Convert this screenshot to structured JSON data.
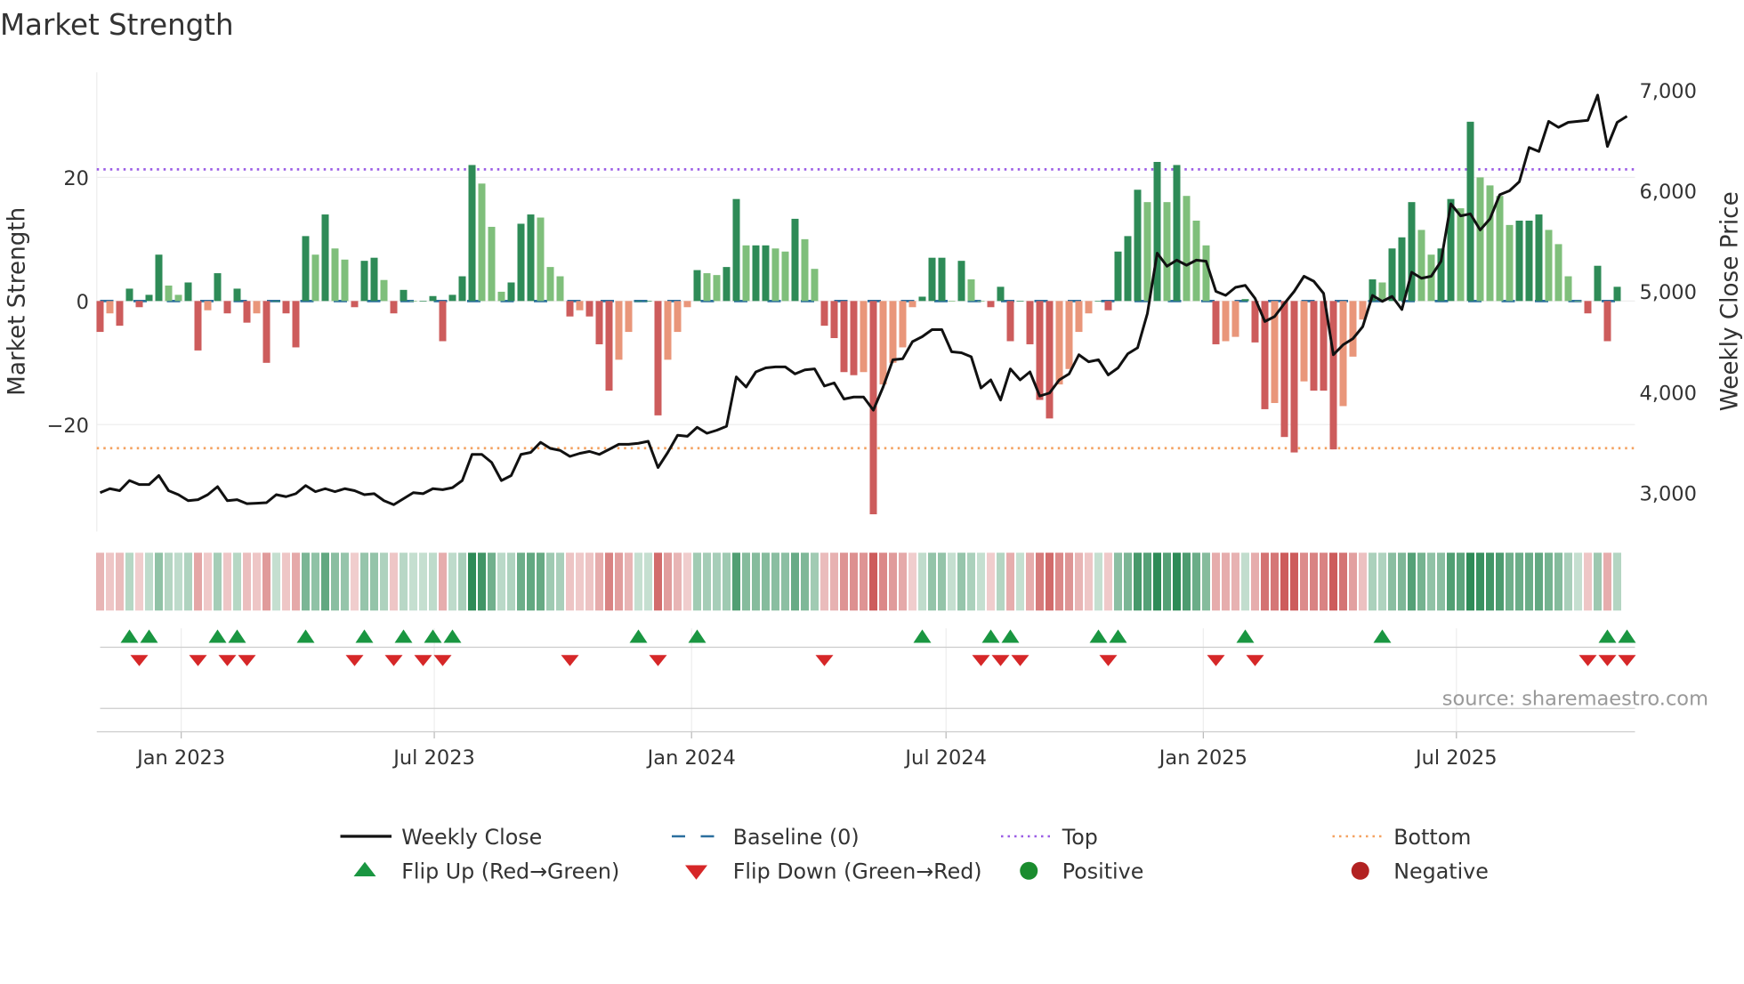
{
  "chart_data": {
    "type": "bar+line",
    "title": "Market Strength",
    "ylabel_left": "Market Strength",
    "ylabel_right": "Weekly Close Price",
    "start_date": "2022-11-04",
    "frequency": "weekly",
    "ylim_left": [
      -37.3,
      37
    ],
    "ylim_right": [
      2613,
      7177
    ],
    "left_ticks": [
      {
        "value": 20,
        "label": "20"
      },
      {
        "value": 0,
        "label": "0"
      },
      {
        "value": -20,
        "label": "−20"
      }
    ],
    "right_ticks": [
      {
        "value": 7000,
        "label": "7,000"
      },
      {
        "value": 6000,
        "label": "6,000"
      },
      {
        "value": 5000,
        "label": "5,000"
      },
      {
        "value": 4000,
        "label": "4,000"
      },
      {
        "value": 3000,
        "label": "3,000"
      }
    ],
    "x_ticks": [
      {
        "date": "2023-01-01",
        "label": "Jan 2023"
      },
      {
        "date": "2023-07-01",
        "label": "Jul 2023"
      },
      {
        "date": "2024-01-01",
        "label": "Jan 2024"
      },
      {
        "date": "2024-07-01",
        "label": "Jul 2024"
      },
      {
        "date": "2025-01-01",
        "label": "Jan 2025"
      },
      {
        "date": "2025-07-01",
        "label": "Jul 2025"
      }
    ],
    "top_level": 21.3,
    "bottom_level": -23.8,
    "strength": [
      -5,
      -2,
      -4,
      2,
      -1,
      1,
      7.5,
      2.5,
      1,
      3,
      -8,
      -1.5,
      4.5,
      -2,
      2,
      -3.5,
      -2,
      -10,
      0,
      -2,
      -7.5,
      10.5,
      7.5,
      14,
      8.5,
      6.7,
      -1,
      6.5,
      7,
      3.4,
      -2,
      1.8,
      0,
      0,
      0.8,
      -6.5,
      1,
      4,
      22,
      19,
      12,
      1.5,
      3,
      12.5,
      14,
      13.5,
      5.5,
      4,
      -2.5,
      -1.5,
      -2.5,
      -7,
      -14.5,
      -9.5,
      -5,
      0,
      0,
      -18.5,
      -9.5,
      -5,
      -1,
      5,
      4.5,
      4.2,
      5.5,
      16.5,
      9,
      9,
      9,
      8.5,
      8,
      13.3,
      10,
      5.2,
      -4,
      -6,
      -11.5,
      -12,
      -11.5,
      -34.5,
      -13.5,
      -10,
      -7.5,
      -1,
      0.7,
      7,
      7,
      0,
      6.5,
      3.5,
      0,
      -1,
      2.3,
      -6.5,
      0,
      -7,
      -16,
      -19,
      -13.5,
      -11,
      -5,
      -2,
      0,
      -1.5,
      8,
      10.5,
      18,
      16,
      22.5,
      16,
      22,
      17,
      13,
      9,
      -7,
      -6.5,
      -5.8,
      0.3,
      -6.7,
      -17.5,
      -16.5,
      -22,
      -24.5,
      -13,
      -14.5,
      -14.5,
      -24,
      -17,
      -9,
      -3,
      3.5,
      3,
      8.5,
      10.3,
      16,
      11.5,
      7.5,
      8.5,
      16.5,
      15,
      29,
      20,
      18.7,
      17,
      12.3,
      13,
      13,
      14,
      11.5,
      9.2,
      4,
      0,
      -2,
      5.7,
      -6.5,
      2.3
    ],
    "weekly_close": [
      3000,
      3040,
      3020,
      3120,
      3080,
      3080,
      3170,
      3020,
      2980,
      2920,
      2930,
      2980,
      3060,
      2920,
      2930,
      2890,
      2895,
      2900,
      2980,
      2960,
      2990,
      3070,
      3010,
      3040,
      3010,
      3040,
      3020,
      2980,
      2990,
      2920,
      2880,
      2940,
      3000,
      2990,
      3040,
      3030,
      3050,
      3120,
      3380,
      3380,
      3300,
      3120,
      3170,
      3380,
      3400,
      3500,
      3440,
      3420,
      3360,
      3390,
      3410,
      3380,
      3430,
      3480,
      3480,
      3490,
      3510,
      3250,
      3400,
      3570,
      3560,
      3650,
      3590,
      3620,
      3660,
      4150,
      4050,
      4200,
      4240,
      4250,
      4250,
      4180,
      4220,
      4230,
      4060,
      4090,
      3930,
      3950,
      3950,
      3820,
      4050,
      4320,
      4330,
      4500,
      4550,
      4620,
      4620,
      4400,
      4390,
      4350,
      4040,
      4120,
      3920,
      4230,
      4120,
      4200,
      3960,
      3990,
      4120,
      4180,
      4370,
      4300,
      4320,
      4170,
      4240,
      4380,
      4440,
      4780,
      5380,
      5250,
      5310,
      5260,
      5310,
      5300,
      5000,
      4960,
      5040,
      5060,
      4930,
      4700,
      4750,
      4880,
      5000,
      5150,
      5100,
      4980,
      4370,
      4470,
      4530,
      4650,
      4960,
      4900,
      4950,
      4820,
      5190,
      5130,
      5150,
      5300,
      5870,
      5750,
      5770,
      5610,
      5720,
      5960,
      6000,
      6090,
      6430,
      6390,
      6690,
      6630,
      6680,
      6690,
      6700,
      6950,
      6440,
      6680,
      6740
    ],
    "flip_up_weeks": [
      3,
      5,
      12,
      14,
      21,
      27,
      31,
      34,
      36,
      55,
      61,
      84,
      91,
      93,
      102,
      104,
      117,
      131,
      154,
      156
    ],
    "flip_down_weeks": [
      4,
      10,
      13,
      15,
      26,
      30,
      33,
      35,
      48,
      57,
      74,
      90,
      92,
      94,
      103,
      114,
      118,
      152,
      154,
      156
    ],
    "legend": [
      {
        "key": "close",
        "label": "Weekly Close"
      },
      {
        "key": "baseline",
        "label": "Baseline (0)"
      },
      {
        "key": "top",
        "label": "Top"
      },
      {
        "key": "bottom",
        "label": "Bottom"
      },
      {
        "key": "flipup",
        "label": "Flip Up (Red→Green)"
      },
      {
        "key": "flipdown",
        "label": "Flip Down (Green→Red)"
      },
      {
        "key": "positive",
        "label": "Positive"
      },
      {
        "key": "negative",
        "label": "Negative"
      }
    ],
    "source": "source: sharemaestro.com",
    "colors": {
      "pos_strong": "#2e8b57",
      "pos_weak": "#7fbf7b",
      "neg_strong": "#cd5c5c",
      "neg_weak": "#e9967a",
      "close": "#111111",
      "baseline": "#2b6f9e",
      "top": "#9b5de5",
      "bottom": "#f4a261",
      "flip_up": "#1a9641",
      "flip_down": "#d62728",
      "positive": "#1a8c2e",
      "negative": "#b22222"
    }
  }
}
